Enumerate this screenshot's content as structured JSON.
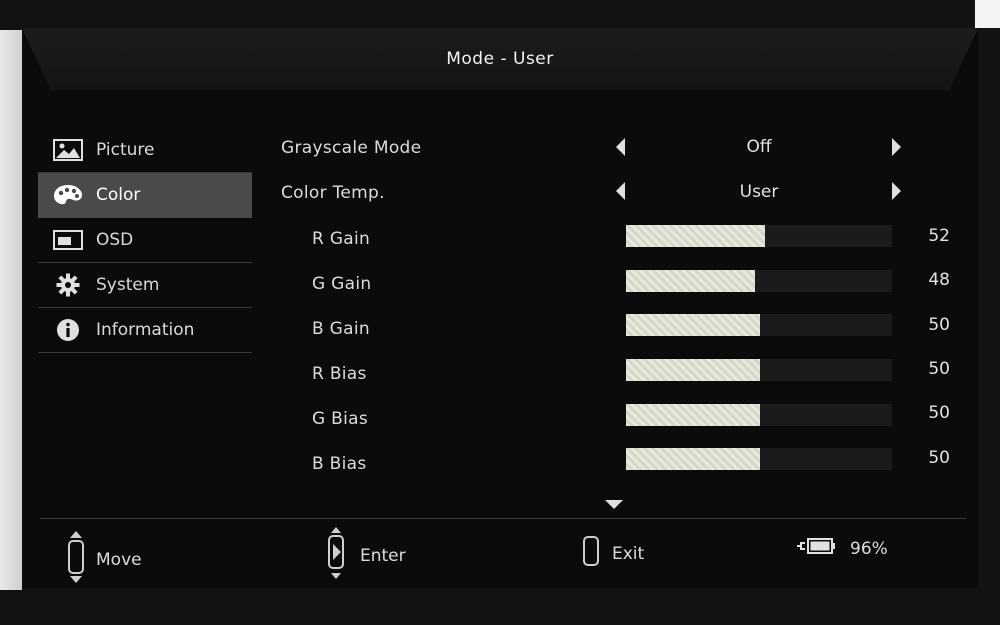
{
  "header": {
    "title": "Mode - User"
  },
  "sidebar": {
    "items": [
      {
        "label": "Picture",
        "icon": "picture-icon",
        "active": false
      },
      {
        "label": "Color",
        "icon": "palette-icon",
        "active": true
      },
      {
        "label": "OSD",
        "icon": "osd-icon",
        "active": false
      },
      {
        "label": "System",
        "icon": "gear-icon",
        "active": false
      },
      {
        "label": "Information",
        "icon": "info-icon",
        "active": false
      }
    ]
  },
  "main": {
    "selectors": [
      {
        "label": "Grayscale Mode",
        "value": "Off"
      },
      {
        "label": "Color Temp.",
        "value": "User"
      }
    ],
    "sliders": [
      {
        "label": "R Gain",
        "value": "52"
      },
      {
        "label": "G Gain",
        "value": "48"
      },
      {
        "label": "B Gain",
        "value": "50"
      },
      {
        "label": "R Bias",
        "value": "50"
      },
      {
        "label": "G Bias",
        "value": "50"
      },
      {
        "label": "B Bias",
        "value": "50"
      }
    ]
  },
  "footer": {
    "move_label": "Move",
    "enter_label": "Enter",
    "exit_label": "Exit",
    "battery_label": "96%"
  },
  "colors": {
    "panel": "#0b0b0c",
    "active_item": "#4a4a4d",
    "bar_fill": "#e8e8dc"
  }
}
